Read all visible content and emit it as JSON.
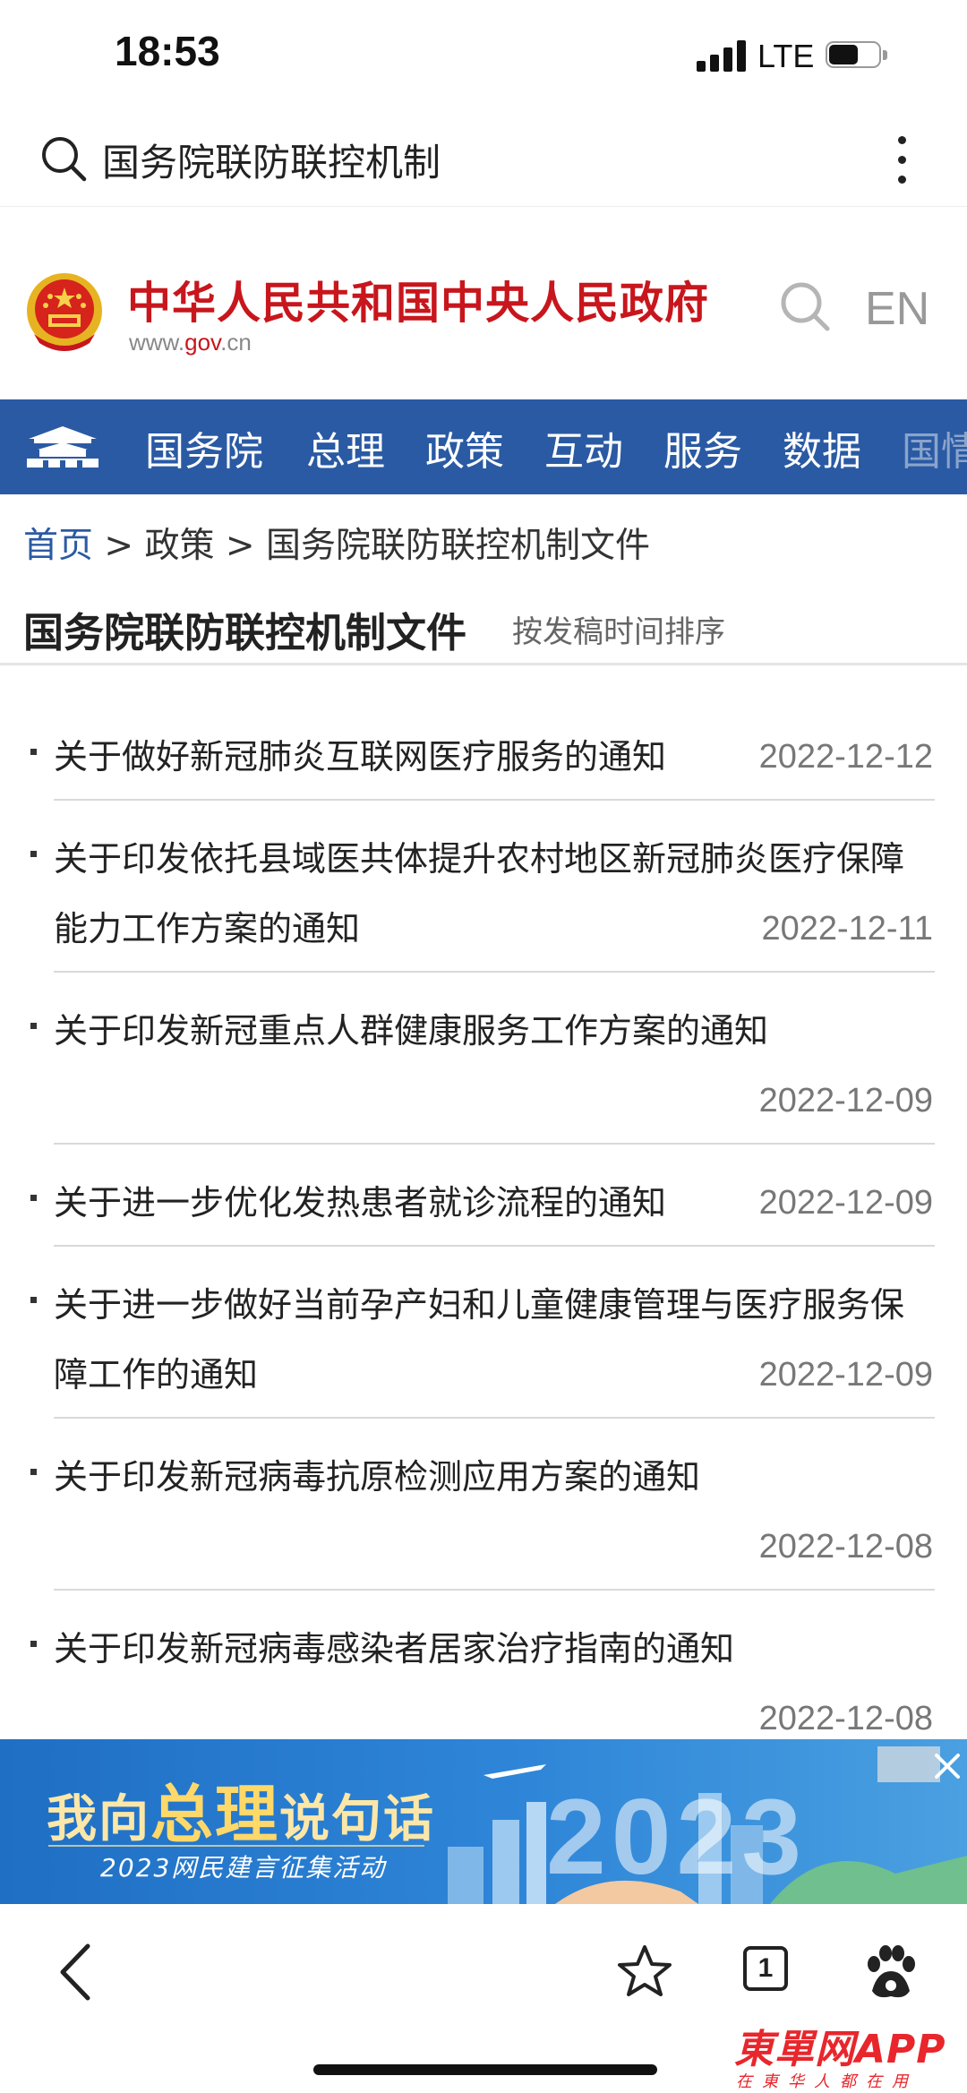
{
  "status_bar": {
    "time": "18:53",
    "network": "LTE",
    "battery_level": 0.6
  },
  "search": {
    "query": "国务院联防联控机制"
  },
  "site": {
    "title": "中华人民共和国中央人民政府",
    "url_prefix": "www.",
    "url_brand": "gov",
    "url_suffix": ".cn",
    "en_label": "EN"
  },
  "nav": {
    "items": [
      "国务院",
      "总理",
      "政策",
      "互动",
      "服务",
      "数据",
      "国情"
    ]
  },
  "breadcrumb": {
    "home": "首页",
    "sep1": " > ",
    "level1": "政策",
    "sep2": " > ",
    "level2": "国务院联防联控机制文件"
  },
  "page": {
    "title": "国务院联防联控机制文件",
    "sort_label": "按发稿时间排序"
  },
  "articles": [
    {
      "title": "关于做好新冠肺炎互联网医疗服务的通知",
      "date": "2022-12-12"
    },
    {
      "title": "关于印发依托县域医共体提升农村地区新冠肺炎医疗保障能力工作方案的通知",
      "date": "2022-12-11"
    },
    {
      "title": "关于印发新冠重点人群健康服务工作方案的通知",
      "date": "2022-12-09"
    },
    {
      "title": "关于进一步优化发热患者就诊流程的通知",
      "date": "2022-12-09"
    },
    {
      "title": "关于进一步做好当前孕产妇和儿童健康管理与医疗服务保障工作的通知",
      "date": "2022-12-09"
    },
    {
      "title": "关于印发新冠病毒抗原检测应用方案的通知",
      "date": "2022-12-08"
    },
    {
      "title": "关于印发新冠病毒感染者居家治疗指南的通知",
      "date": "2022-12-08"
    }
  ],
  "banner": {
    "part1": "我向",
    "part2": "总理",
    "part3": "说句话",
    "subtitle": "2023网民建言征集活动",
    "year": "2023"
  },
  "toolbar": {
    "tab_count": "1"
  },
  "watermark": {
    "main": "東單网APP",
    "sub": "在東华人都在用"
  },
  "colors": {
    "brand_red": "#c8161d",
    "nav_blue": "#2a5aa3",
    "link_blue": "#2a5aa3"
  }
}
